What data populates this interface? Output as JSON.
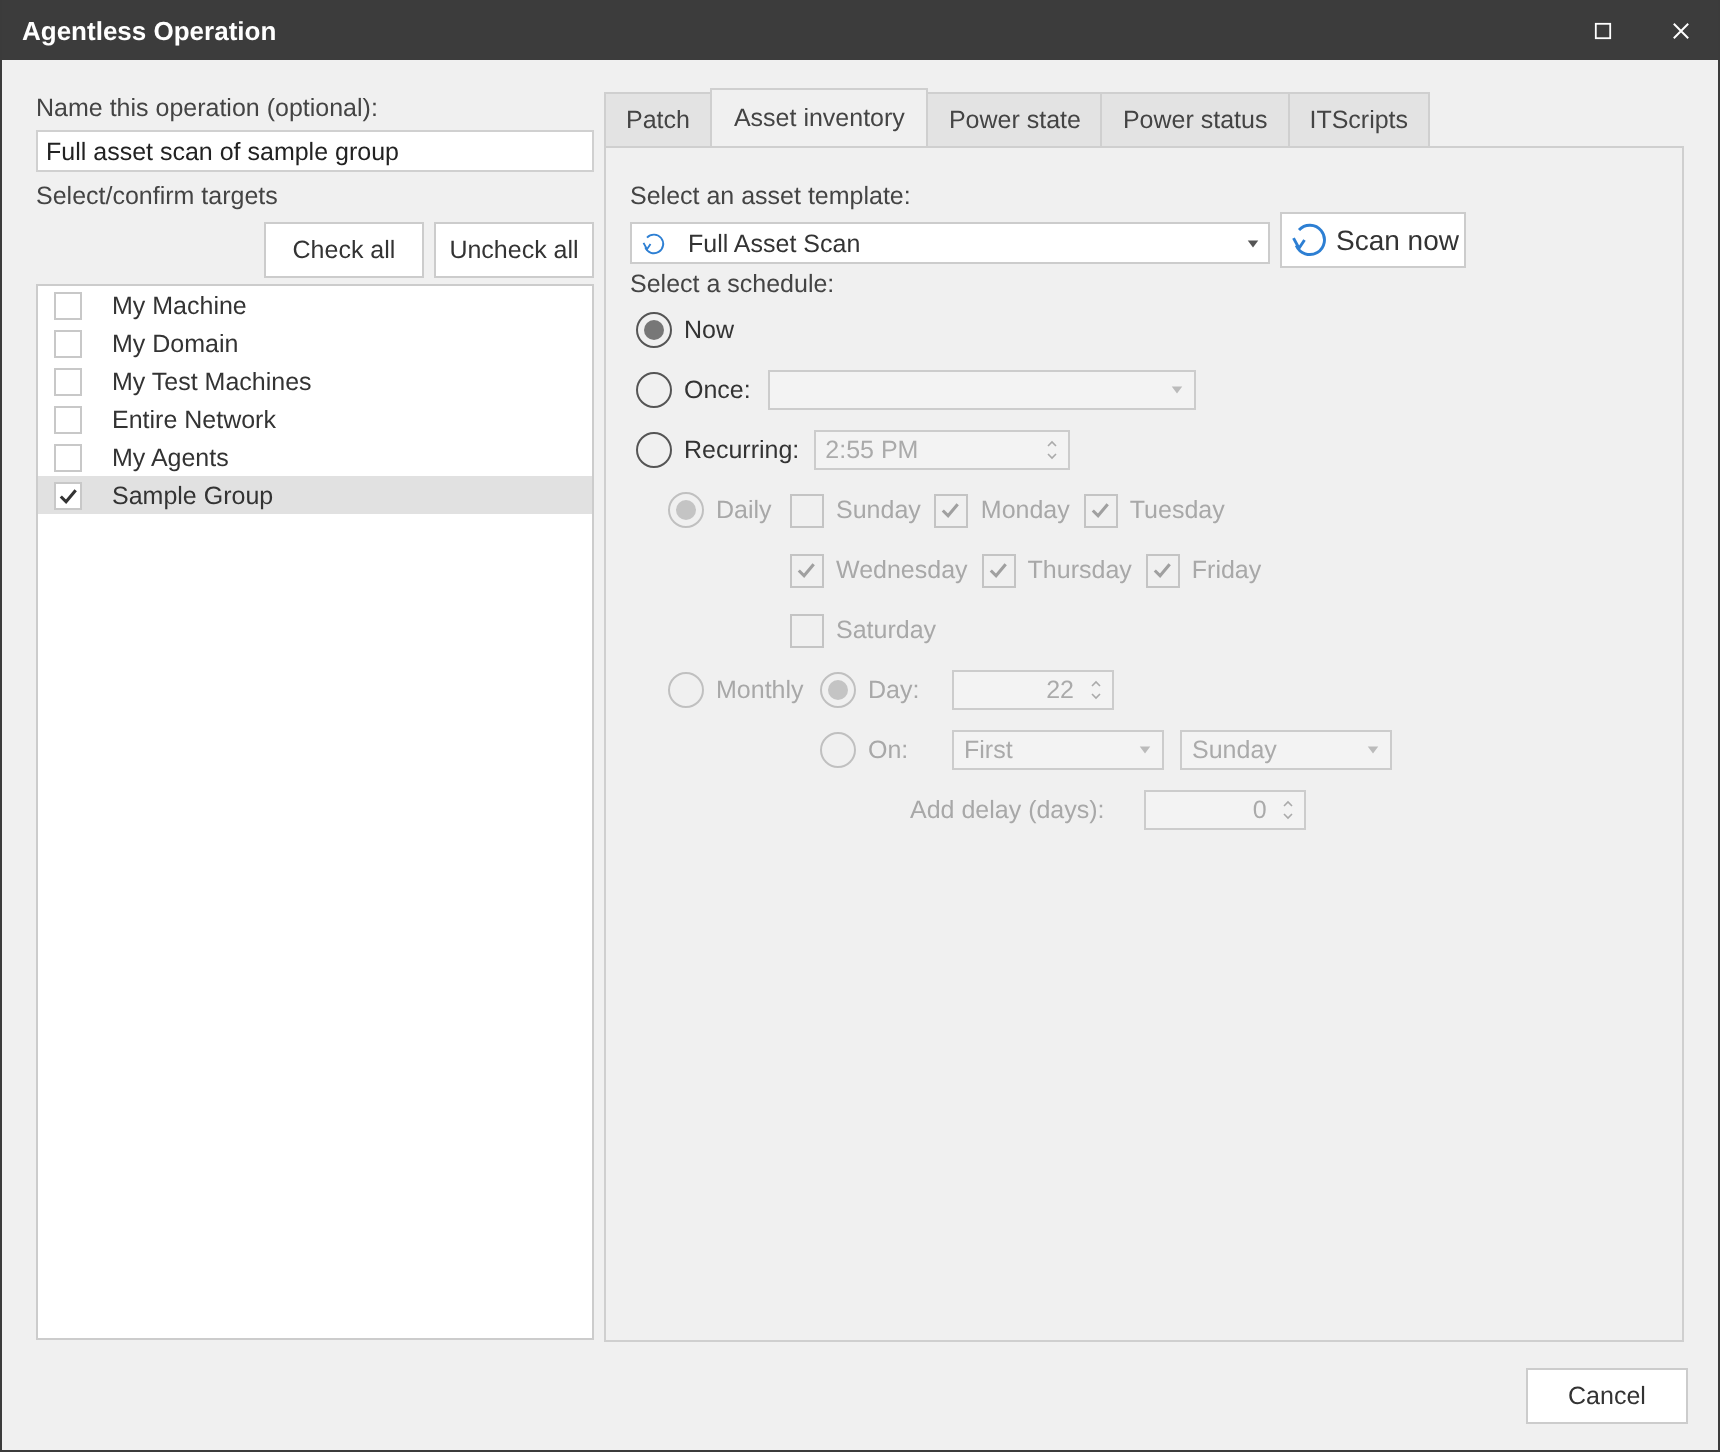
{
  "window": {
    "title": "Agentless Operation"
  },
  "name_field": {
    "label": "Name this operation (optional):",
    "value": "Full asset scan of sample group"
  },
  "targets": {
    "label": "Select/confirm targets",
    "buttons": [
      "Check all",
      "Uncheck all"
    ],
    "items": [
      {
        "label": "My Machine",
        "checked": false,
        "selected": false
      },
      {
        "label": "My Domain",
        "checked": false,
        "selected": false
      },
      {
        "label": "My Test Machines",
        "checked": false,
        "selected": false
      },
      {
        "label": "Entire Network",
        "checked": false,
        "selected": false
      },
      {
        "label": "My Agents",
        "checked": false,
        "selected": false
      },
      {
        "label": "Sample Group",
        "checked": true,
        "selected": true
      }
    ]
  },
  "tabs": [
    {
      "label": "Patch",
      "selected": false
    },
    {
      "label": "Asset inventory",
      "selected": true
    },
    {
      "label": "Power state",
      "selected": false
    },
    {
      "label": "Power status",
      "selected": false
    },
    {
      "label": "ITScripts",
      "selected": false
    }
  ],
  "asset_inventory": {
    "template_label": "Select an asset template:",
    "template_value": "Full Asset Scan",
    "scan_button": "Scan now",
    "schedule_label": "Select a schedule:",
    "schedule_options": [
      {
        "label": "Now",
        "selected": true,
        "kind": "plain"
      },
      {
        "label": "Once:",
        "selected": false,
        "kind": "dropdown"
      },
      {
        "label": "Recurring:",
        "selected": false,
        "kind": "time",
        "value": "2:55 PM"
      }
    ],
    "recurring": {
      "disabled": true,
      "daily": {
        "label": "Daily",
        "selected": true
      },
      "days": [
        {
          "label": "Sunday",
          "checked": false
        },
        {
          "label": "Monday",
          "checked": true
        },
        {
          "label": "Tuesday",
          "checked": true
        },
        {
          "label": "Wednesday",
          "checked": true
        },
        {
          "label": "Thursday",
          "checked": true
        },
        {
          "label": "Friday",
          "checked": true
        },
        {
          "label": "Saturday",
          "checked": false
        }
      ],
      "monthly": {
        "label": "Monthly",
        "selected": false
      },
      "day_option": {
        "label": "Day:",
        "selected": true,
        "value": "22"
      },
      "on_option": {
        "label": "On:",
        "selected": false,
        "week": "First",
        "weekday": "Sunday"
      },
      "delay": {
        "label": "Add delay (days):",
        "value": "0"
      }
    }
  },
  "buttons": [
    "Cancel"
  ]
}
